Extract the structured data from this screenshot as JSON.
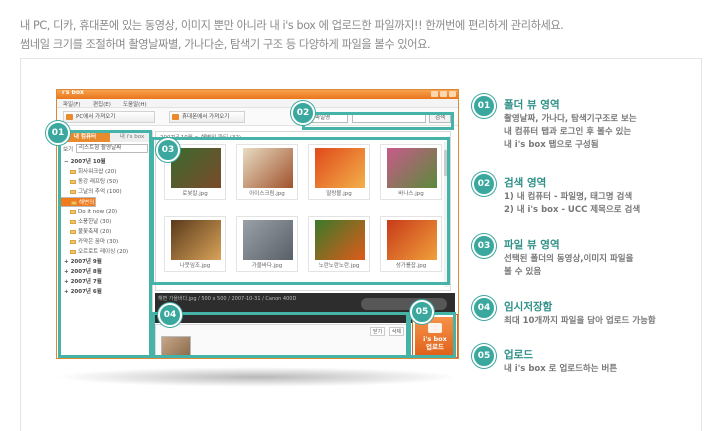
{
  "intro": {
    "line1": "내 PC, 디카, 휴대폰에 있는 동영상, 이미지 뿐만 아니라 내 i's box 에 업로드한 파일까지!! 한꺼번에 편리하게 관리하세요.",
    "line2": "썸네일 크기를 조절하며 촬영날짜별, 가나다순, 탐색기 구조 등 다양하게 파일을 볼수 있어요."
  },
  "app": {
    "title": "i's box",
    "menu": [
      "파일(F)",
      "편집(E)",
      "도움말(H)"
    ],
    "toolbar": {
      "pc_import": "PC에서 가져오기",
      "phone_import": "휴대폰에서 가져오기"
    },
    "search": {
      "select": "파일명",
      "button": "검색"
    },
    "tabs": {
      "my_computer": "내 컴퓨터",
      "my_isbox": "내 i's box"
    },
    "view": {
      "label": "보기",
      "value": "리스트형 촬영날짜"
    },
    "tree": [
      {
        "label": "2007년 10월",
        "kind": "year"
      },
      {
        "label": "회사워크샵 (20)",
        "kind": "folder"
      },
      {
        "label": "동강 래프팅 (50)",
        "kind": "folder"
      },
      {
        "label": "그날의 추억 (100)",
        "kind": "folder"
      },
      {
        "label": "해변의 파티 (32)",
        "kind": "selected"
      },
      {
        "label": "Do it now (20)",
        "kind": "folder"
      },
      {
        "label": "소풍한날 (30)",
        "kind": "folder"
      },
      {
        "label": "불꽃축제 (20)",
        "kind": "folder"
      },
      {
        "label": "카약은 꿈마 (30)",
        "kind": "folder"
      },
      {
        "label": "오르로트 레이싱 (20)",
        "kind": "folder"
      },
      {
        "label": "2007년 9월",
        "kind": "year"
      },
      {
        "label": "2007년 8월",
        "kind": "year"
      },
      {
        "label": "2007년 7월",
        "kind": "year"
      },
      {
        "label": "2007년 6월",
        "kind": "year"
      }
    ],
    "breadcrumb": "2007년 10월 > 해변의 파티 (32)",
    "thumbnails": [
      {
        "caption": "로봇칼.jpg",
        "colors": [
          "#3b6a2f",
          "#7a4a2a"
        ]
      },
      {
        "caption": "아이스크림.jpg",
        "colors": [
          "#e8dcc2",
          "#a0522d"
        ]
      },
      {
        "caption": "딸랑볼.jpg",
        "colors": [
          "#e04a1a",
          "#f3b04a"
        ]
      },
      {
        "caption": "바나스.jpg",
        "colors": [
          "#c85a8a",
          "#5a8a3a"
        ]
      },
      {
        "caption": "나뭇잎조.jpg",
        "colors": [
          "#5a3a1a",
          "#d9a35a"
        ]
      },
      {
        "caption": "가을바다.jpg",
        "colors": [
          "#9aa0a8",
          "#5a6068"
        ]
      },
      {
        "caption": "노란노란노란.jpg",
        "colors": [
          "#3a7a2a",
          "#e05a1a"
        ]
      },
      {
        "caption": "성가를잡.jpg",
        "colors": [
          "#c83a1a",
          "#f0a03a"
        ]
      }
    ],
    "player_info": "해변 가을바다.jpg / 500 x 500 / 2007-10-31 / Canon 400D",
    "temp_buttons": [
      "닫기",
      "삭제"
    ],
    "upload": {
      "line1": "i's box",
      "line2": "업로드"
    }
  },
  "callouts": [
    "01",
    "02",
    "03",
    "04",
    "05"
  ],
  "legend": [
    {
      "num": "01",
      "title": "폴더 뷰 영역",
      "lines": [
        "촬영날짜, 가나다, 탐색기구조로 보는",
        "내 컴퓨터 탭과 로그인 후 볼수 있는",
        "내 i's box 탭으로 구성됨"
      ]
    },
    {
      "num": "02",
      "title": "검색 영역",
      "lines": [
        "1) 내 컴퓨터 - 파일명, 태그명 검색",
        "2) 내 i's box - UCC 제목으로 검색"
      ]
    },
    {
      "num": "03",
      "title": "파일 뷰 영역",
      "lines": [
        "선택된 폴더의 동영상,이미지 파일을",
        "볼 수 있음"
      ]
    },
    {
      "num": "04",
      "title": "임시저장함",
      "lines": [
        "최대 10개까지 파일을 담아 업로드 가능함"
      ]
    },
    {
      "num": "05",
      "title": "업로드",
      "lines": [
        "내 i's box 로 업로드하는 버튼"
      ]
    }
  ],
  "colors": {
    "accent": "#3aa89e",
    "orange": "#e98a2f"
  }
}
